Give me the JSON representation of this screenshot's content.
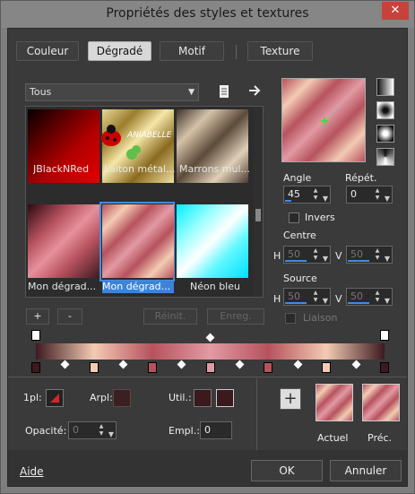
{
  "window": {
    "title": "Propriétés des styles et textures",
    "close_glyph": "✕"
  },
  "tabs": [
    {
      "label": "Couleur",
      "active": false
    },
    {
      "label": "Dégradé",
      "active": true
    },
    {
      "label": "Motif",
      "active": false
    },
    {
      "label": "Texture",
      "active": false
    }
  ],
  "category": {
    "selected": "Tous"
  },
  "thumbnails": [
    {
      "label": "JBlackNRed",
      "selected": false
    },
    {
      "label": "Laiton métal...",
      "selected": false
    },
    {
      "label": "Marrons mul...",
      "selected": false
    },
    {
      "label": "Mon dégrad...",
      "selected": false
    },
    {
      "label": "Mon dégrad...",
      "selected": true
    },
    {
      "label": "Néon bleu",
      "selected": false
    }
  ],
  "watermark": "ANIABELLE",
  "list_buttons": {
    "add": "+",
    "remove": "-",
    "reset": "Réinit.",
    "save": "Enreg."
  },
  "angle": {
    "label": "Angle",
    "value": "45",
    "fill": 0.13
  },
  "repeat": {
    "label": "Répét.",
    "value": "0"
  },
  "invert": {
    "label": "Invers",
    "checked": false
  },
  "center": {
    "label": "Centre",
    "h_label": "H",
    "h_value": "50",
    "v_label": "V",
    "v_value": "50"
  },
  "source": {
    "label": "Source",
    "h_label": "H",
    "h_value": "50",
    "v_label": "V",
    "v_value": "50"
  },
  "link": {
    "label": "Liaison",
    "checked": false
  },
  "gradient": {
    "stops_colors": [
      "#3d1a20",
      "#f3cbb3",
      "#b6525e",
      "#e29aa3",
      "#b6525e",
      "#f3cbb3",
      "#3d1a20"
    ]
  },
  "bottom_left": {
    "pl_label": "1pl:",
    "arpl_label": "Arpl:",
    "util_label": "Util.:",
    "opacity_label": "Opacité:",
    "opacity_value": "0",
    "empl_label": "Empl.:",
    "empl_value": "0"
  },
  "bottom_right": {
    "add_glyph": "+",
    "current_label": "Actuel",
    "previous_label": "Préc."
  },
  "dialog": {
    "help": "Aide",
    "ok": "OK",
    "cancel": "Annuler"
  },
  "colors": {
    "accent": "#3d8ee6",
    "close": "#c7423a"
  }
}
